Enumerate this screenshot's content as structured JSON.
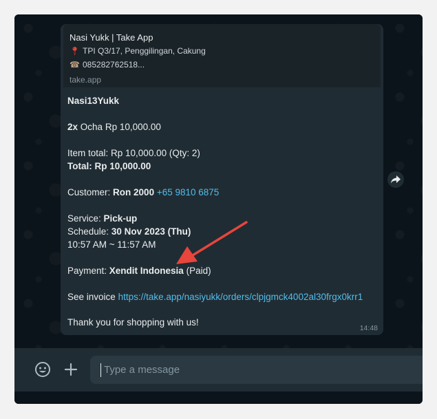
{
  "link_preview": {
    "title": "Nasi Yukk | Take App",
    "address_icon": "pin-icon",
    "address": "TPI Q3/17, Penggilingan, Cakung",
    "phone_icon": "phone-icon",
    "phone": "085282762518...",
    "domain": "take.app"
  },
  "message": {
    "shop_name": "Nasi13Yukk",
    "item_qty": "2x",
    "item_desc": "Ocha Rp 10,000.00",
    "item_total": "Item total: Rp 10,000.00 (Qty: 2)",
    "total": "Total: Rp 10,000.00",
    "customer_label": "Customer:",
    "customer_name": "Ron 2000",
    "customer_phone": "+65 9810 6875",
    "service_label": "Service:",
    "service_value": "Pick-up",
    "schedule_label": "Schedule:",
    "schedule_value": "30 Nov 2023 (Thu)",
    "time_range": "10:57 AM ~ 11:57 AM",
    "payment_label": "Payment:",
    "payment_method": "Xendit Indonesia",
    "payment_status": "(Paid)",
    "invoice_label": "See invoice",
    "invoice_link": "https://take.app/nasiyukk/orders/clpjgmck4002al30frgx0krr1",
    "thanks": "Thank you for shopping with us!",
    "timestamp": "14:48"
  },
  "composer": {
    "emoji_icon": "emoji-icon",
    "attach_icon": "plus-icon",
    "placeholder": "Type a message"
  },
  "colors": {
    "bubble": "#202c33",
    "link": "#53bdeb",
    "annotation_arrow": "#e8453c"
  }
}
